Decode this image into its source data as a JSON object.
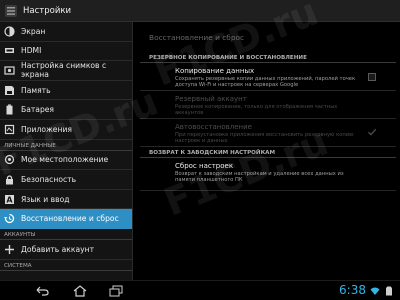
{
  "actionbar": {
    "title": "Настройки",
    "icon": "settings-app-icon"
  },
  "sidebar": {
    "rows": [
      {
        "type": "item",
        "name": "sidebar-item-screen",
        "icon": "screen-icon",
        "label": "Экран"
      },
      {
        "type": "item",
        "name": "sidebar-item-hdmi",
        "icon": "hdmi-icon",
        "label": "HDMI"
      },
      {
        "type": "item",
        "name": "sidebar-item-screenshot-settings",
        "icon": "screenshot-icon",
        "label": "Настройка снимков с экрана"
      },
      {
        "type": "item",
        "name": "sidebar-item-storage",
        "icon": "storage-icon",
        "label": "Память"
      },
      {
        "type": "item",
        "name": "sidebar-item-battery",
        "icon": "battery-icon",
        "label": "Батарея"
      },
      {
        "type": "item",
        "name": "sidebar-item-apps",
        "icon": "apps-icon",
        "label": "Приложения"
      },
      {
        "type": "header",
        "name": "sidebar-header-personal",
        "label": "ЛИЧНЫЕ ДАННЫЕ"
      },
      {
        "type": "item",
        "name": "sidebar-item-location",
        "icon": "location-icon",
        "label": "Мое местоположение"
      },
      {
        "type": "item",
        "name": "sidebar-item-security",
        "icon": "lock-icon",
        "label": "Безопасность"
      },
      {
        "type": "item",
        "name": "sidebar-item-language",
        "icon": "language-icon",
        "label": "Язык и ввод"
      },
      {
        "type": "item",
        "name": "sidebar-item-backup-reset",
        "icon": "backup-icon",
        "label": "Восстановление и сброс",
        "selected": true
      },
      {
        "type": "header",
        "name": "sidebar-header-accounts",
        "label": "АККАУНТЫ"
      },
      {
        "type": "item",
        "name": "sidebar-item-add-account",
        "icon": "plus-icon",
        "label": "Добавить аккаунт"
      },
      {
        "type": "header",
        "name": "sidebar-header-system",
        "label": "СИСТЕМА"
      }
    ]
  },
  "content": {
    "title": "Восстановление и сброс",
    "section_backup": "РЕЗЕРВНОЕ КОПИРОВАНИЕ И ВОССТАНОВЛЕНИЕ",
    "backup_data": {
      "title": "Копирование данных",
      "summary": "Сохранять резервные копии данных приложений, паролей точек доступа Wi-Fi и настроек на серверах Google",
      "checked": false
    },
    "backup_account": {
      "title": "Резервный аккаунт",
      "summary": "Резервное копирование, только для отображения частных аккаунтов"
    },
    "auto_restore": {
      "title": "Автовосстановление",
      "summary": "При переустановке приложения восстановить резервную копию настроек и данных",
      "checked": true
    },
    "section_reset": "ВОЗВРАТ К ЗАВОДСКИМ НАСТРОЙКАМ",
    "factory_reset": {
      "title": "Сброс настроек",
      "summary": "Возврат к заводским настройкам и удаление всех данных из памяти планшетного ПК"
    }
  },
  "navbar": {
    "clock": "6:38",
    "buttons": [
      "back-icon",
      "home-icon",
      "recent-apps-icon"
    ],
    "status_icons": [
      "wifi-icon",
      "battery-icon"
    ]
  },
  "watermark": "F1CD.ru",
  "colors": {
    "accent": "#2e8fc4",
    "clock": "#33b5e5"
  }
}
